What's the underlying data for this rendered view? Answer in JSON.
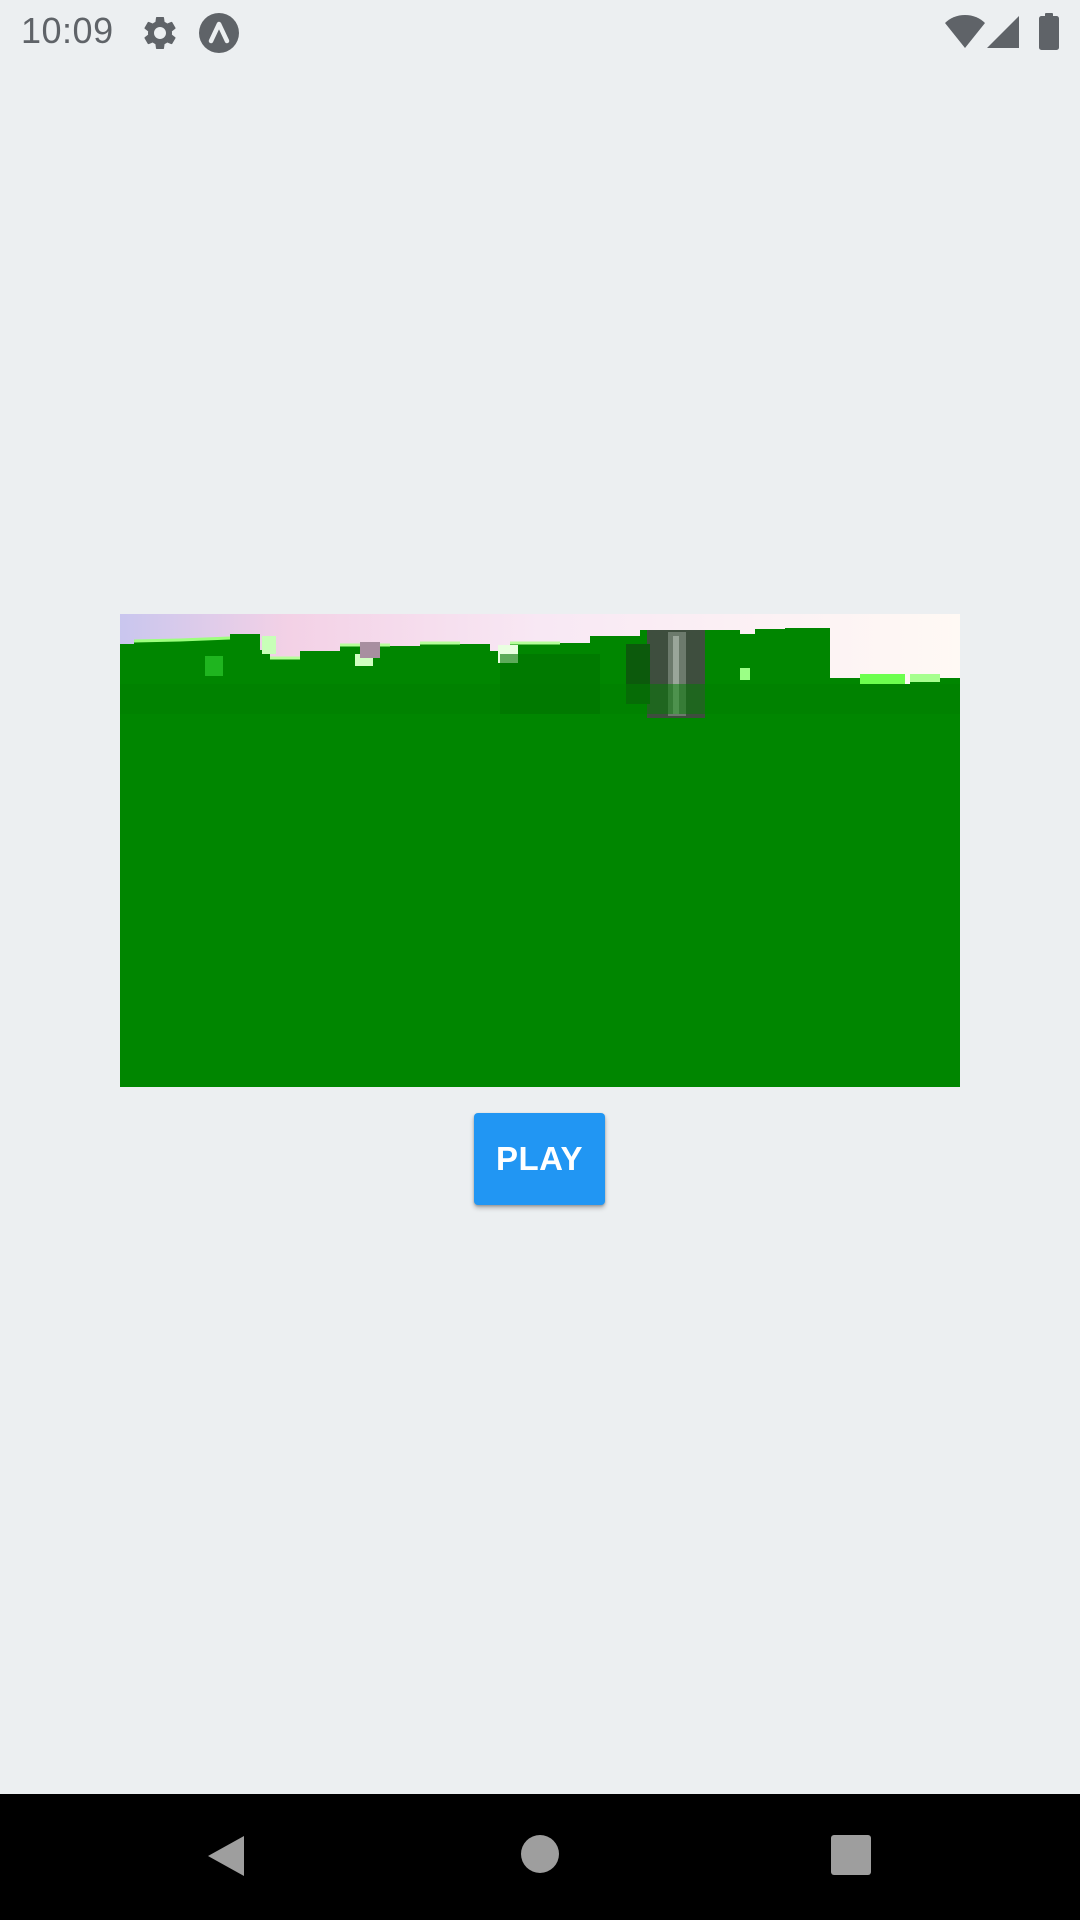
{
  "status_bar": {
    "time": "10:09",
    "icons": [
      "gear-icon",
      "app-icon",
      "wifi-icon",
      "signal-icon",
      "battery-icon"
    ],
    "icon_color": "#5f6368"
  },
  "video": {
    "background_color": "#008600",
    "sky_color": "#F5E9F3"
  },
  "play_button": {
    "label": "PLAY",
    "color": "#2196F3",
    "text_color": "#FFFFFF"
  },
  "nav_bar": {
    "buttons": [
      "back-icon",
      "home-icon",
      "recents-icon"
    ],
    "background": "#000000",
    "icon_color": "#9E9E9E"
  },
  "theme": {
    "background": "#ECEFF1"
  }
}
